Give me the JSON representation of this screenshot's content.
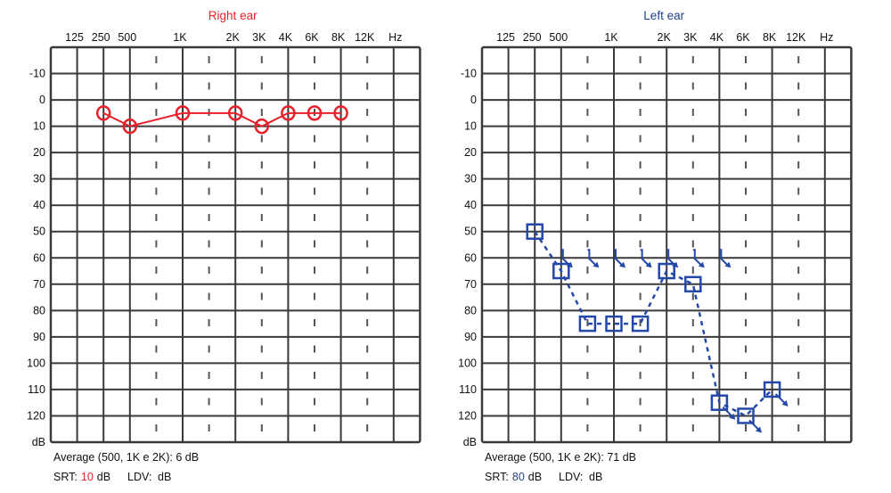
{
  "chart_data": [
    {
      "type": "line",
      "title": "Right ear",
      "title_color": "#e8202a",
      "x_tick_labels": [
        "125",
        "250",
        "500",
        "1K",
        "2K",
        "3K",
        "4K",
        "6K",
        "8K",
        "12K",
        "Hz"
      ],
      "y_tick_labels": [
        "-10",
        "0",
        "10",
        "20",
        "30",
        "40",
        "50",
        "60",
        "70",
        "80",
        "90",
        "100",
        "110",
        "120",
        "dB"
      ],
      "ylim": [
        -20,
        130
      ],
      "y_inverted": true,
      "grid": true,
      "series": [
        {
          "symbol": "circle",
          "color": "#e8202a",
          "line": "solid",
          "x": [
            "250",
            "500",
            "1K",
            "2K",
            "3K",
            "4K",
            "6K",
            "8K"
          ],
          "y": [
            5,
            10,
            5,
            5,
            10,
            5,
            5,
            5
          ]
        }
      ],
      "footer": {
        "average_label": "Average (500, 1K e 2K): 6 dB",
        "srt_prefix": "SRT:",
        "srt_value": "10",
        "srt_unit": "dB",
        "ldv_label": "LDV:",
        "ldv_unit": "dB"
      }
    },
    {
      "type": "line",
      "title": "Left ear",
      "title_color": "#1f3f8f",
      "x_tick_labels": [
        "125",
        "250",
        "500",
        "1K",
        "2K",
        "3K",
        "4K",
        "6K",
        "8K",
        "12K",
        "Hz"
      ],
      "y_tick_labels": [
        "-10",
        "0",
        "10",
        "20",
        "30",
        "40",
        "50",
        "60",
        "70",
        "80",
        "90",
        "100",
        "110",
        "120",
        "dB"
      ],
      "ylim": [
        -20,
        130
      ],
      "y_inverted": true,
      "grid": true,
      "series": [
        {
          "symbol": "square",
          "color": "#2448a8",
          "line": "dashed",
          "x": [
            "250",
            "500",
            "750",
            "1K",
            "1.5K",
            "2K",
            "3K",
            "4K",
            "6K",
            "8K"
          ],
          "y": [
            50,
            65,
            85,
            85,
            85,
            65,
            70,
            115,
            120,
            110
          ],
          "no_response": [
            "4K",
            "6K",
            "8K"
          ]
        },
        {
          "symbol": "bone-no-response-arrow",
          "color": "#2448a8",
          "x": [
            "500",
            "750",
            "1K",
            "1.5K",
            "2K",
            "3K",
            "4K"
          ],
          "y": [
            60,
            60,
            60,
            60,
            60,
            60,
            60
          ]
        }
      ],
      "footer": {
        "average_label": "Average (500, 1K e 2K): 71 dB",
        "srt_prefix": "SRT:",
        "srt_value": "80",
        "srt_unit": "dB",
        "ldv_label": "LDV:",
        "ldv_unit": "dB"
      }
    }
  ]
}
